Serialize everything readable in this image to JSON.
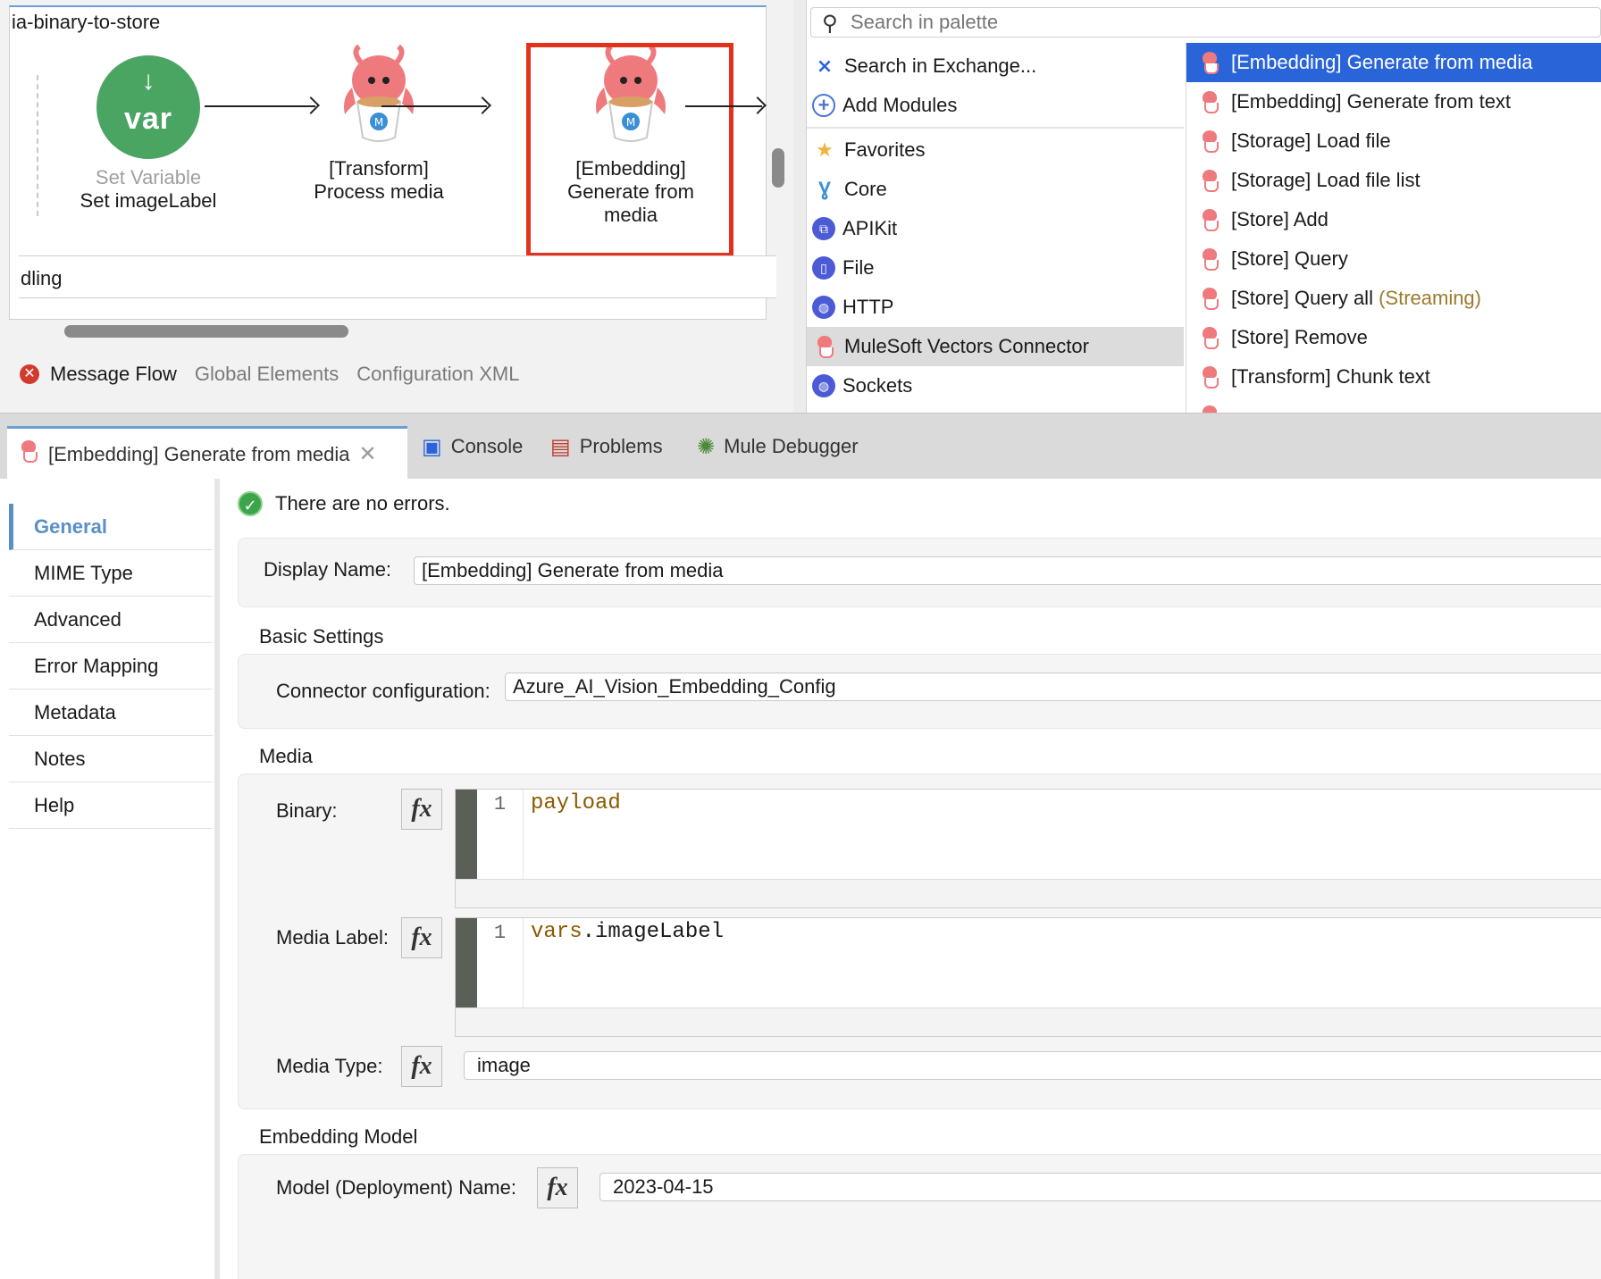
{
  "canvas": {
    "flow_name": "ia-binary-to-store",
    "nodes": [
      {
        "icon": "var",
        "caption_gray": "Set Variable",
        "caption": "Set imageLabel"
      },
      {
        "caption_line1": "[Transform]",
        "caption_line2": "Process media"
      },
      {
        "caption_line1": "[Embedding]",
        "caption_line2": "Generate from",
        "caption_line3": "media"
      }
    ],
    "handling_label": "dling",
    "var_arrow": "↓",
    "editor_tabs": {
      "message_flow": "Message Flow",
      "global_elements": "Global Elements",
      "configuration_xml": "Configuration XML"
    }
  },
  "palette": {
    "search_placeholder": "Search in palette",
    "categories": [
      {
        "label": "Search in Exchange...",
        "icon": "exchange-icon"
      },
      {
        "label": "Add Modules",
        "icon": "plus-circle-icon"
      },
      {
        "label": "Favorites",
        "icon": "star-icon"
      },
      {
        "label": "Core",
        "icon": "core-icon"
      },
      {
        "label": "APIKit",
        "icon": "apikit-icon"
      },
      {
        "label": "File",
        "icon": "file-icon"
      },
      {
        "label": "HTTP",
        "icon": "globe-icon"
      },
      {
        "label": "MuleSoft Vectors Connector",
        "icon": "octopus-icon"
      },
      {
        "label": "Sockets",
        "icon": "globe-icon"
      }
    ],
    "operations": [
      {
        "label": "[Embedding] Generate from media"
      },
      {
        "label": "[Embedding] Generate from text"
      },
      {
        "label": "[Storage] Load file"
      },
      {
        "label": "[Storage] Load file list"
      },
      {
        "label": "[Store] Add"
      },
      {
        "label": "[Store] Query"
      },
      {
        "label": "[Store] Query all ",
        "suffix": "(Streaming)"
      },
      {
        "label": "[Store] Remove"
      },
      {
        "label": "[Transform] Chunk text"
      }
    ]
  },
  "bottom_tabs": {
    "active": "[Embedding] Generate from media",
    "console": "Console",
    "problems": "Problems",
    "debugger": "Mule Debugger"
  },
  "side_nav": [
    "General",
    "MIME Type",
    "Advanced",
    "Error Mapping",
    "Metadata",
    "Notes",
    "Help"
  ],
  "status": "There are no errors.",
  "form": {
    "display_name_label": "Display Name:",
    "display_name_value": "[Embedding] Generate from media",
    "basic_settings_title": "Basic Settings",
    "connector_config_label": "Connector configuration:",
    "connector_config_value": "Azure_AI_Vision_Embedding_Config",
    "media_title": "Media",
    "binary_label": "Binary:",
    "binary_line": "1",
    "binary_code": "payload",
    "media_label_label": "Media Label:",
    "media_label_line": "1",
    "media_label_code_kw": "vars",
    "media_label_code_rest": ".imageLabel",
    "media_type_label": "Media Type:",
    "media_type_value": "image",
    "embedding_model_title": "Embedding Model",
    "model_name_label": "Model (Deployment) Name:",
    "model_name_value": "2023-04-15",
    "fx_label": "fx"
  },
  "colors": {
    "selection_blue": "#2a64d9",
    "highlight_red": "#e2321e",
    "var_green": "#4aa563",
    "nav_blue": "#5a8fc7"
  }
}
